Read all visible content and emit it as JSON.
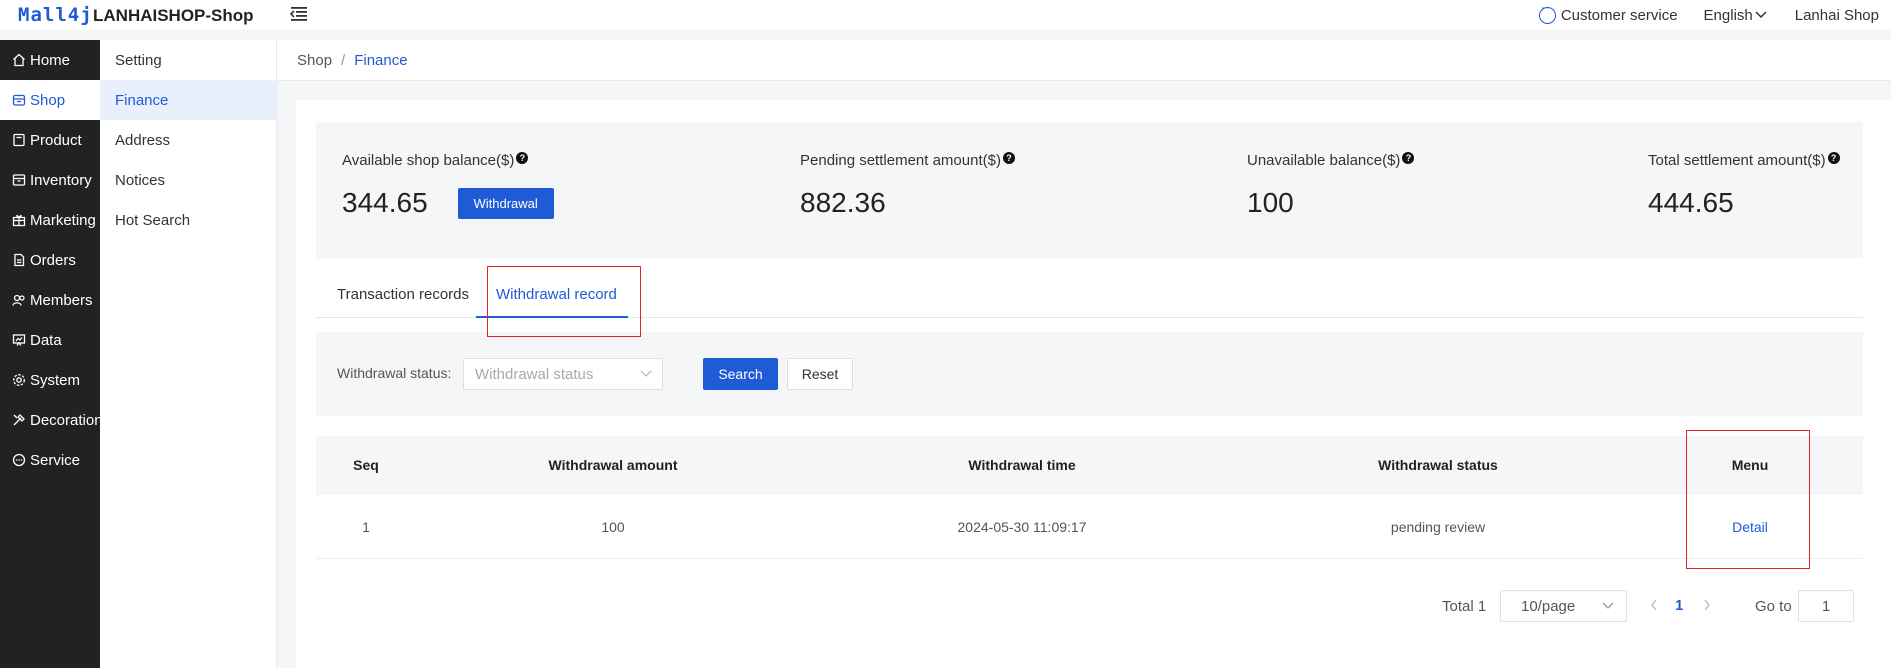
{
  "header": {
    "logo_text": "Mall4j",
    "shop_name": "LANHAISHOP-Shop",
    "customer_service": "Customer service",
    "language": "English",
    "user": "Lanhai Shop"
  },
  "sidebar": {
    "items": [
      {
        "label": "Home",
        "icon": "home-icon"
      },
      {
        "label": "Shop",
        "icon": "shop-icon",
        "active": true
      },
      {
        "label": "Product",
        "icon": "product-icon"
      },
      {
        "label": "Inventory",
        "icon": "inventory-icon"
      },
      {
        "label": "Marketing",
        "icon": "gift-icon"
      },
      {
        "label": "Orders",
        "icon": "document-icon"
      },
      {
        "label": "Members",
        "icon": "members-icon"
      },
      {
        "label": "Data",
        "icon": "data-icon"
      },
      {
        "label": "System",
        "icon": "gear-icon"
      },
      {
        "label": "Decoration",
        "icon": "decoration-icon"
      },
      {
        "label": "Service",
        "icon": "chat-icon"
      }
    ]
  },
  "submenu": {
    "items": [
      {
        "label": "Setting"
      },
      {
        "label": "Finance",
        "active": true
      },
      {
        "label": "Address"
      },
      {
        "label": "Notices"
      },
      {
        "label": "Hot Search"
      }
    ]
  },
  "breadcrumb": {
    "shop": "Shop",
    "separator": "/",
    "current": "Finance"
  },
  "balances": {
    "available_label": "Available shop balance($)",
    "available_value": "344.65",
    "withdraw_label": "Withdrawal",
    "pending_label": "Pending settlement amount($)",
    "pending_value": "882.36",
    "unavailable_label": "Unavailable balance($)",
    "unavailable_value": "100",
    "total_label": "Total settlement amount($)",
    "total_value": "444.65",
    "help_glyph": "?"
  },
  "tabs": {
    "transaction": "Transaction records",
    "withdrawal": "Withdrawal record"
  },
  "search": {
    "status_label": "Withdrawal status:",
    "status_placeholder": "Withdrawal status",
    "search_label": "Search",
    "reset_label": "Reset"
  },
  "table": {
    "columns": [
      "Seq",
      "Withdrawal amount",
      "Withdrawal time",
      "Withdrawal status",
      "Menu"
    ],
    "rows": [
      {
        "seq": "1",
        "amount": "100",
        "time": "2024-05-30 11:09:17",
        "status": "pending review",
        "action": "Detail"
      }
    ]
  },
  "pagination": {
    "total": "Total 1",
    "page_size": "10/page",
    "current_page": "1",
    "goto_label": "Go to",
    "goto_value": "1"
  },
  "colors": {
    "accent": "#1f5bd6",
    "sidebar_bg": "#222222",
    "annotation": "#e0202a"
  }
}
